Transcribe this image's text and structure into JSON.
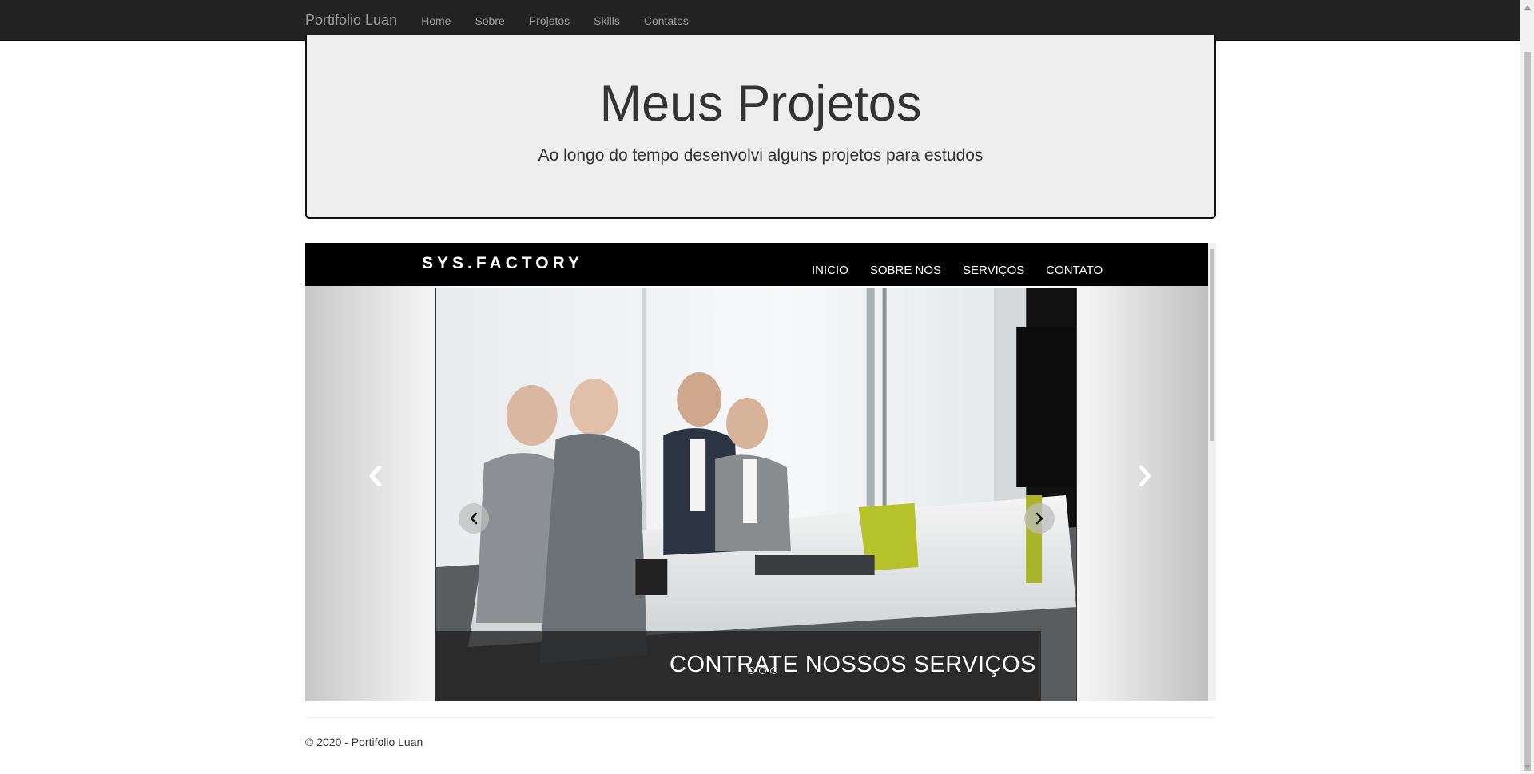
{
  "navbar": {
    "brand": "Portifolio Luan",
    "links": [
      "Home",
      "Sobre",
      "Projetos",
      "Skills",
      "Contatos"
    ]
  },
  "jumbotron": {
    "title": "Meus Projetos",
    "subtitle": "Ao longo do tempo desenvolvi alguns projetos para estudos"
  },
  "project": {
    "logo": "SYS.FACTORY",
    "menu": [
      "INICIO",
      "SOBRE NÓS",
      "SERVIÇOS",
      "CONTATO"
    ],
    "slide_caption": "CONTRATE NOSSOS SERVIÇOS",
    "slide_image": "business-meeting-handshake-photo",
    "icons": {
      "inner_prev": "chevron-left-icon",
      "inner_next": "chevron-right-icon",
      "outer_prev": "chevron-left-icon",
      "outer_next": "chevron-right-icon"
    }
  },
  "footer": {
    "text": "© 2020 - Portifolio Luan"
  },
  "colors": {
    "navbar_bg": "#222222",
    "nav_text": "#9d9d9d",
    "jumbotron_bg": "#eeeeee",
    "project_header_bg": "#000000"
  }
}
